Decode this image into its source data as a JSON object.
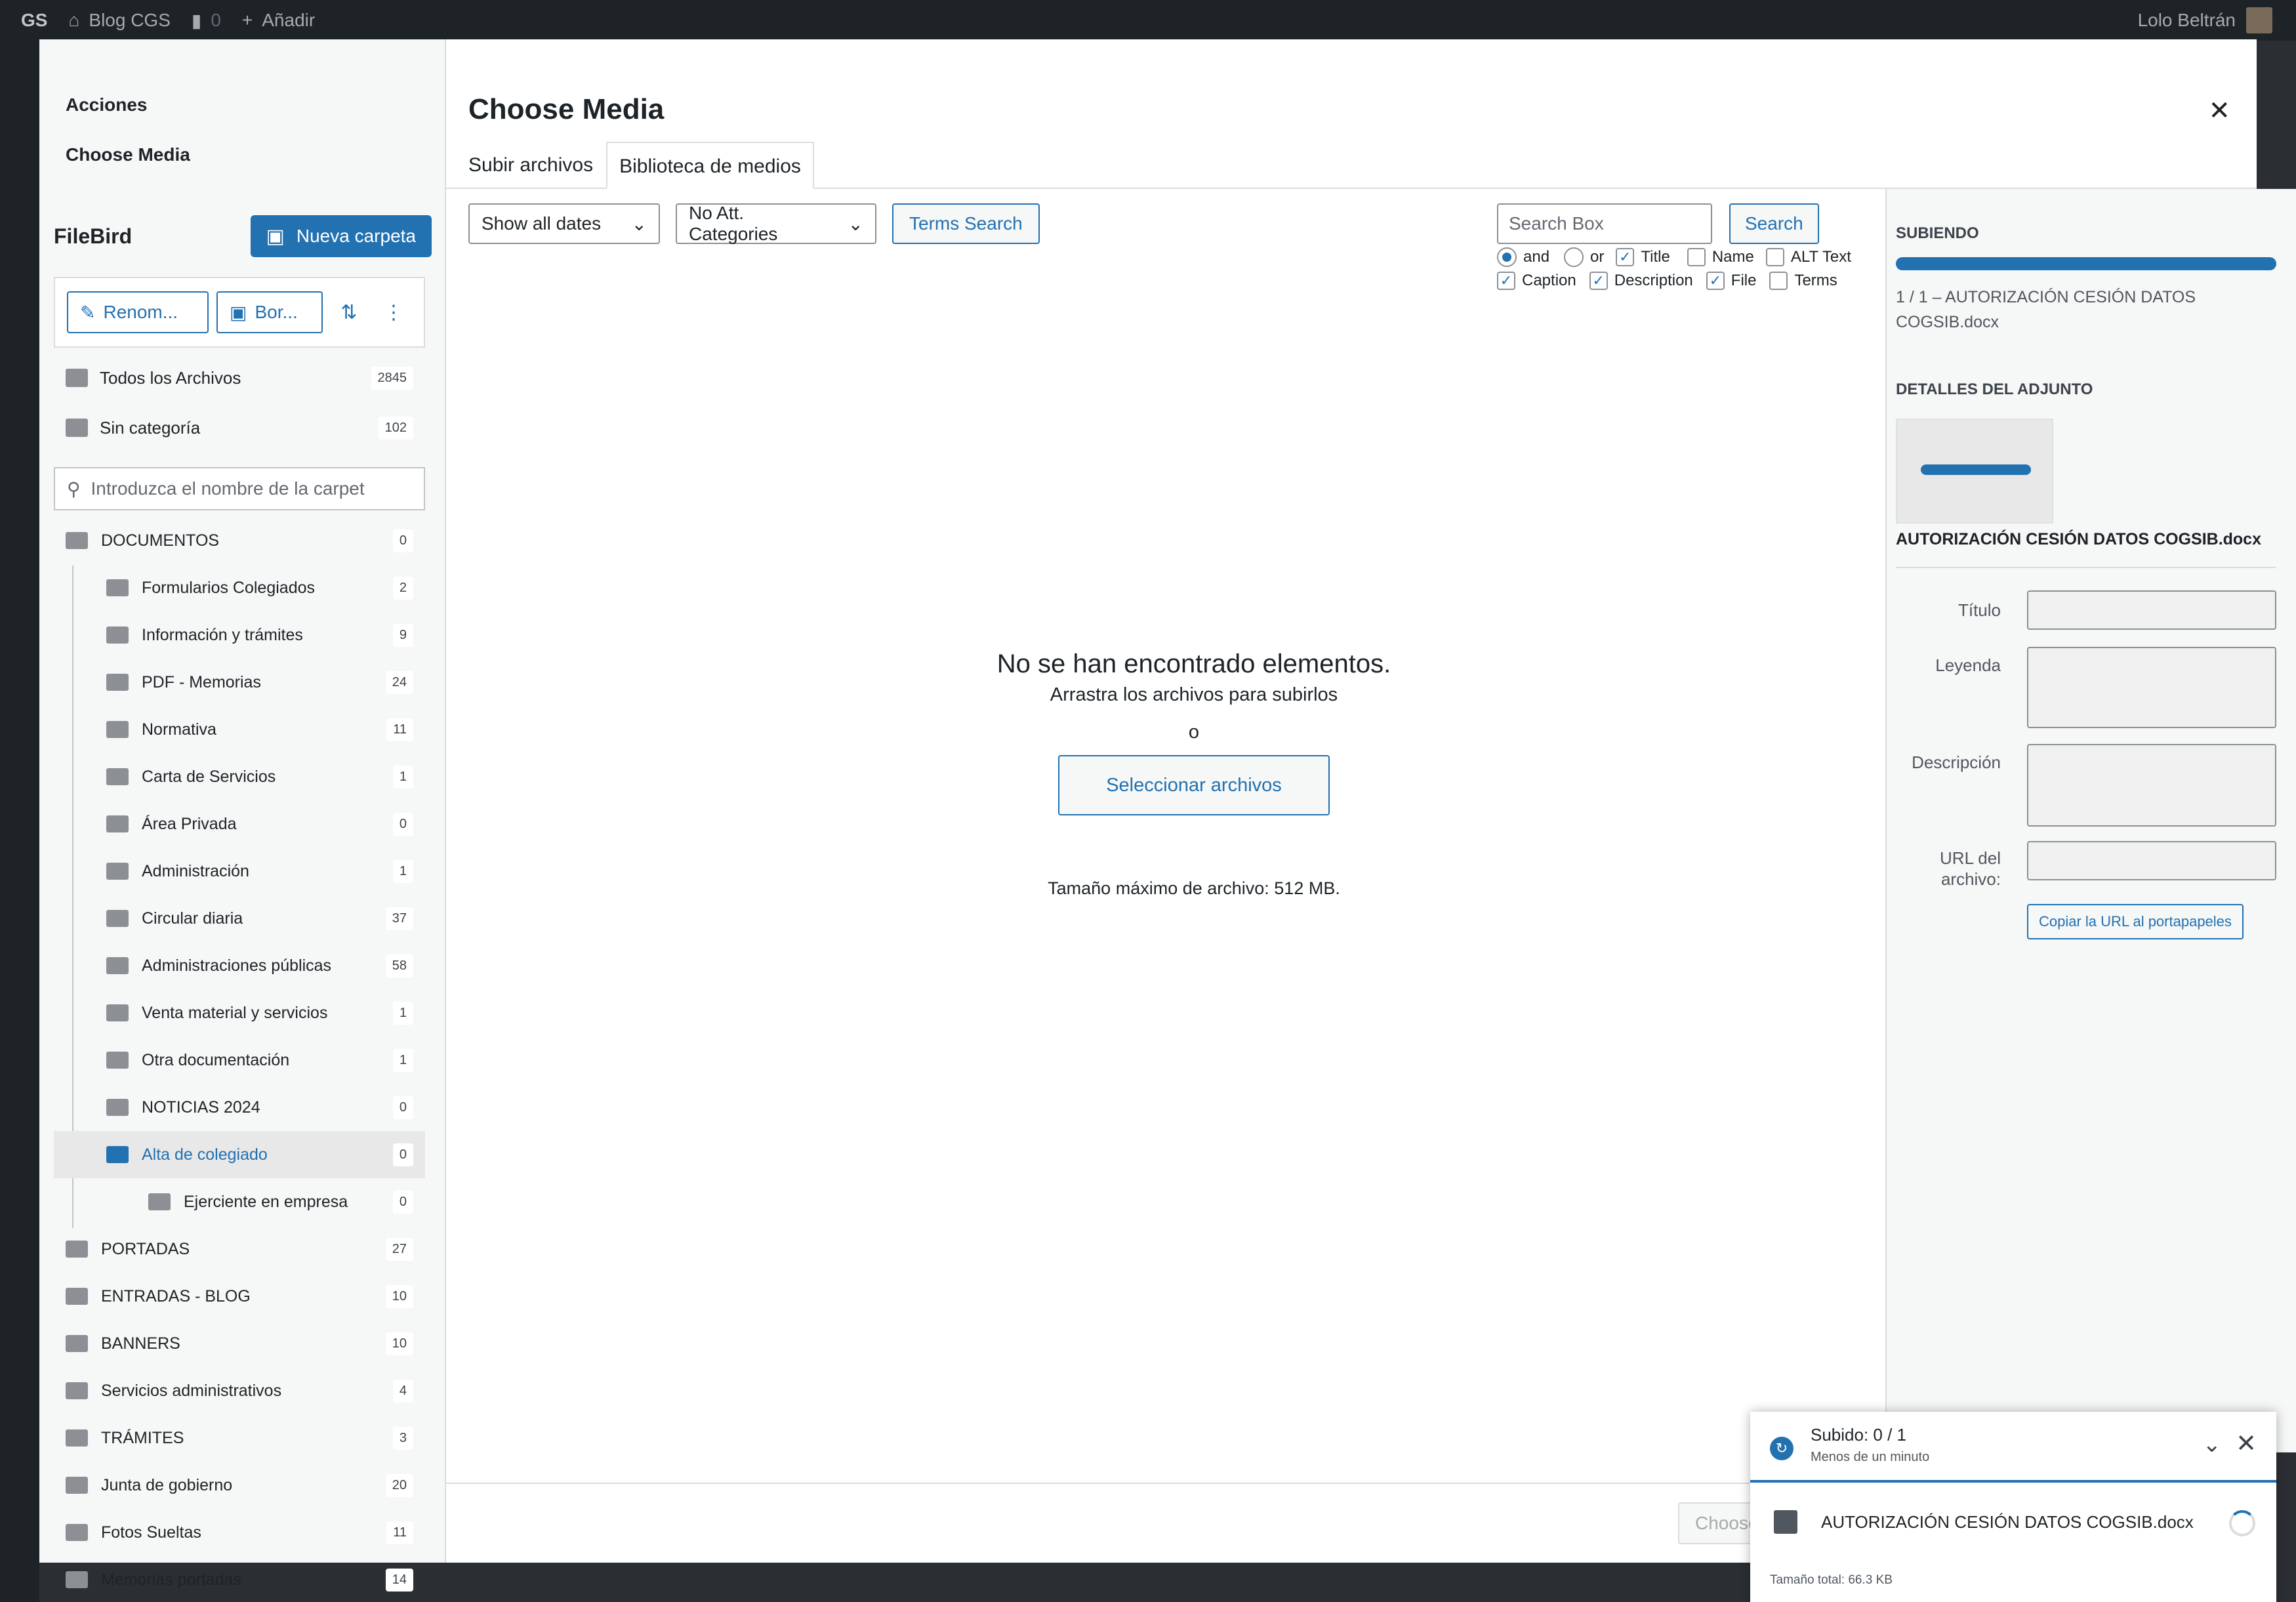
{
  "adminbar": {
    "logo": "GS",
    "site": "Blog CGS",
    "comments": "0",
    "add": "Añadir",
    "user": "Lolo Beltrán"
  },
  "menu": {
    "acciones": "Acciones",
    "choose_media": "Choose Media"
  },
  "filebird": {
    "title": "FileBird",
    "new_folder": "Nueva carpeta",
    "rename": "Renom...",
    "delete": "Bor...",
    "all_files": "Todos los Archivos",
    "all_files_count": "2845",
    "uncategorized": "Sin categoría",
    "uncategorized_count": "102",
    "search_placeholder": "Introduzca el nombre de la carpet"
  },
  "folders": [
    {
      "name": "DOCUMENTOS",
      "count": "0",
      "level": 0
    },
    {
      "name": "Formularios Colegiados",
      "count": "2",
      "level": 1
    },
    {
      "name": "Información y trámites",
      "count": "9",
      "level": 1
    },
    {
      "name": "PDF - Memorias",
      "count": "24",
      "level": 1
    },
    {
      "name": "Normativa",
      "count": "11",
      "level": 1
    },
    {
      "name": "Carta de Servicios",
      "count": "1",
      "level": 1
    },
    {
      "name": "Área Privada",
      "count": "0",
      "level": 1
    },
    {
      "name": "Administración",
      "count": "1",
      "level": 1
    },
    {
      "name": "Circular diaria",
      "count": "37",
      "level": 1
    },
    {
      "name": "Administraciones públicas",
      "count": "58",
      "level": 1
    },
    {
      "name": "Venta material y servicios",
      "count": "1",
      "level": 1
    },
    {
      "name": "Otra documentación",
      "count": "1",
      "level": 1
    },
    {
      "name": "NOTICIAS 2024",
      "count": "0",
      "level": 1
    },
    {
      "name": "Alta de colegiado",
      "count": "0",
      "level": 1,
      "selected": true
    },
    {
      "name": "Ejerciente en empresa",
      "count": "0",
      "level": 2
    },
    {
      "name": "PORTADAS",
      "count": "27",
      "level": 0
    },
    {
      "name": "ENTRADAS - BLOG",
      "count": "10",
      "level": 0
    },
    {
      "name": "BANNERS",
      "count": "10",
      "level": 0
    },
    {
      "name": "Servicios administrativos",
      "count": "4",
      "level": 0
    },
    {
      "name": "TRÁMITES",
      "count": "3",
      "level": 0
    },
    {
      "name": "Junta de gobierno",
      "count": "20",
      "level": 0
    },
    {
      "name": "Fotos Sueltas",
      "count": "11",
      "level": 0
    },
    {
      "name": "Memorias portadas",
      "count": "14",
      "level": 0
    }
  ],
  "main": {
    "title": "Choose Media",
    "tab_upload": "Subir archivos",
    "tab_library": "Biblioteca de medios",
    "filter_dates": "Show all dates",
    "filter_categories": "No Att. Categories",
    "terms_search": "Terms Search",
    "search_placeholder": "Search Box",
    "search_btn": "Search",
    "opt_and": "and",
    "opt_or": "or",
    "opt_title": "Title",
    "opt_name": "Name",
    "opt_alt": "ALT Text",
    "opt_caption": "Caption",
    "opt_description": "Description",
    "opt_file": "File",
    "opt_terms": "Terms",
    "empty_heading": "No se han encontrado elementos.",
    "empty_drag": "Arrastra los archivos para subirlos",
    "empty_or": "o",
    "select_files": "Seleccionar archivos",
    "max_size": "Tamaño máximo de archivo: 512 MB.",
    "choose_button": "Choose"
  },
  "details": {
    "uploading": "SUBIENDO",
    "upload_progress": 1.0,
    "upload_line": "1 / 1  –  AUTORIZACIÓN CESIÓN DATOS COGSIB.docx",
    "attachment_heading": "DETALLES DEL ADJUNTO",
    "filename": "AUTORIZACIÓN CESIÓN DATOS COGSIB.docx",
    "label_title": "Título",
    "label_caption": "Leyenda",
    "label_description": "Descripción",
    "label_url": "URL del archivo:",
    "copy_url": "Copiar la URL al portapapeles"
  },
  "toast": {
    "status": "Subido: 0 / 1",
    "time": "Menos de un minuto",
    "file": "AUTORIZACIÓN CESIÓN DATOS COGSIB.docx",
    "total": "Tamaño total: 66.3 KB"
  }
}
